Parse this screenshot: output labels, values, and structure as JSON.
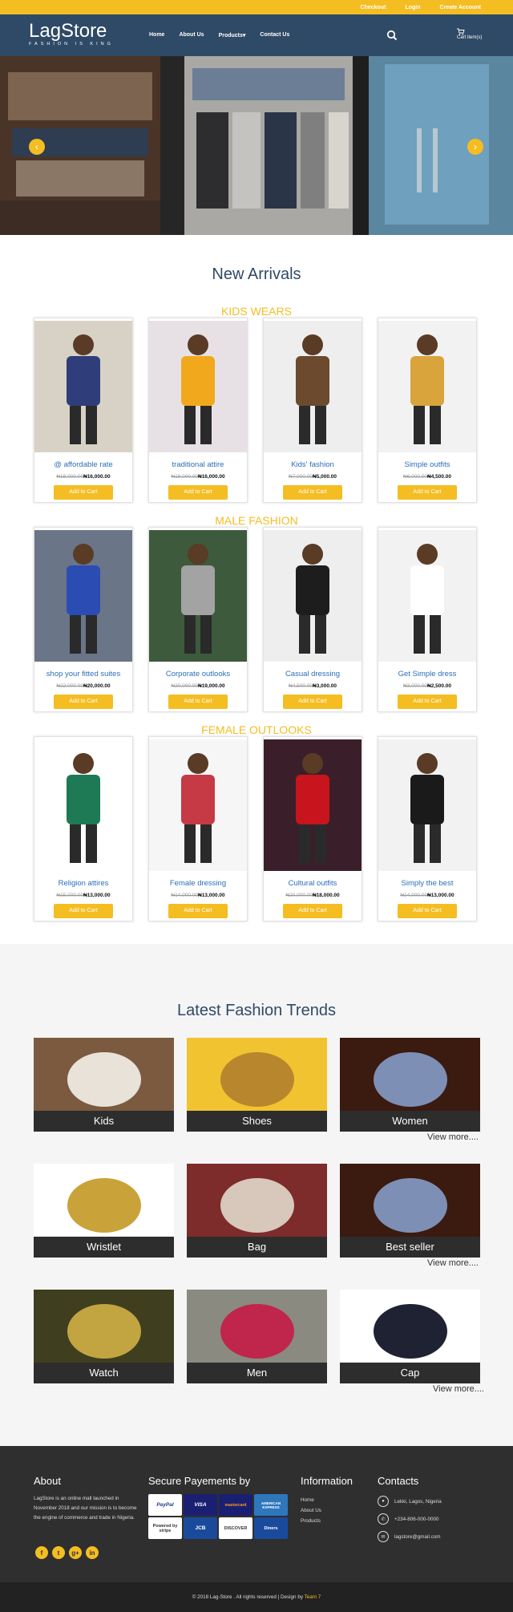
{
  "topbar": {
    "links": [
      "Checkout",
      "Login",
      "Create Account"
    ]
  },
  "header": {
    "brand_name": "LagStore",
    "brand_tagline": "FASHION IS KING",
    "nav": [
      "Home",
      "About Us",
      "Products",
      "Contact Us"
    ],
    "products_caret": "▾",
    "cart_label": "Cart item(s)"
  },
  "hero": {
    "prev_icon": "‹",
    "next_icon": "›"
  },
  "arrivals": {
    "title": "New Arrivals",
    "categories": [
      {
        "title": "KIDS WEARS",
        "products": [
          {
            "name": "@ affordable rate",
            "old_price": "₦18,000.00",
            "price": "₦16,000.00",
            "button": "Add to Cart"
          },
          {
            "name": "traditional attire",
            "old_price": "₦18,000.00",
            "price": "₦16,000.00",
            "button": "Add to Cart"
          },
          {
            "name": "Kids' fashion",
            "old_price": "₦7,000.00",
            "price": "₦5,000.00",
            "button": "Add to Cart"
          },
          {
            "name": "Simple outfits",
            "old_price": "₦6,000.00",
            "price": "₦4,500.00",
            "button": "Add to Cart"
          }
        ]
      },
      {
        "title": "MALE FASHION",
        "products": [
          {
            "name": "shop your fitted suites",
            "old_price": "₦22,000.00",
            "price": "₦20,000.00",
            "button": "Add to Cart"
          },
          {
            "name": "Corporate outlooks",
            "old_price": "₦20,000.00",
            "price": "₦19,000.00",
            "button": "Add to Cart"
          },
          {
            "name": "Casual dressing",
            "old_price": "₦4,500.00",
            "price": "₦3,000.00",
            "button": "Add to Cart"
          },
          {
            "name": "Get Simple dress",
            "old_price": "₦3,000.00",
            "price": "₦2,500.00",
            "button": "Add to Cart"
          }
        ]
      },
      {
        "title": "FEMALE OUTLOOKS",
        "products": [
          {
            "name": "Religion attires",
            "old_price": "₦15,000.00",
            "price": "₦13,000.00",
            "button": "Add to Cart"
          },
          {
            "name": "Female dressing",
            "old_price": "₦14,000.00",
            "price": "₦13,000.00",
            "button": "Add to Cart"
          },
          {
            "name": "Cultural outfits",
            "old_price": "₦20,000.00",
            "price": "₦18,000.00",
            "button": "Add to Cart"
          },
          {
            "name": "Simply the best",
            "old_price": "₦14,000.00",
            "price": "₦13,000.00",
            "button": "Add to Cart"
          }
        ]
      }
    ]
  },
  "trends": {
    "title": "Latest Fashion Trends",
    "rows": [
      {
        "tiles": [
          "Kids",
          "Shoes",
          "Women"
        ],
        "view_more": "View more...."
      },
      {
        "tiles": [
          "Wristlet",
          "Bag",
          "Best seller"
        ],
        "view_more": "View more...."
      },
      {
        "tiles": [
          "Watch",
          "Men",
          "Cap"
        ],
        "view_more": "View more...."
      }
    ]
  },
  "footer": {
    "about_title": "About",
    "about_text": "LagStore is an online mall launched in November 2018 and our mission is to become the engine of commerce and trade in Nigeria.",
    "social": [
      "f",
      "t",
      "g+",
      "in"
    ],
    "payments_title": "Secure Payements by",
    "payments": [
      "PayPal",
      "VISA",
      "mastercard",
      "AMERICAN EXPRESS",
      "Powered by stripe",
      "JCB",
      "DISCOVER",
      "Diners"
    ],
    "info_title": "Information",
    "info_links": [
      "Home",
      "About Us",
      "Products"
    ],
    "contacts_title": "Contacts",
    "contacts": [
      "Lekki, Lagos, Nigeria",
      "+234-806-000-0000",
      "lagstore@gmail.com"
    ],
    "copyright": "© 2018 Lag-Store . All rights reserved | Design by",
    "team": "Team 7"
  },
  "colors": {
    "accent": "#f4bd22",
    "navy": "#2f4a66",
    "link": "#2a6ebb",
    "footer": "#2f2f2f"
  }
}
